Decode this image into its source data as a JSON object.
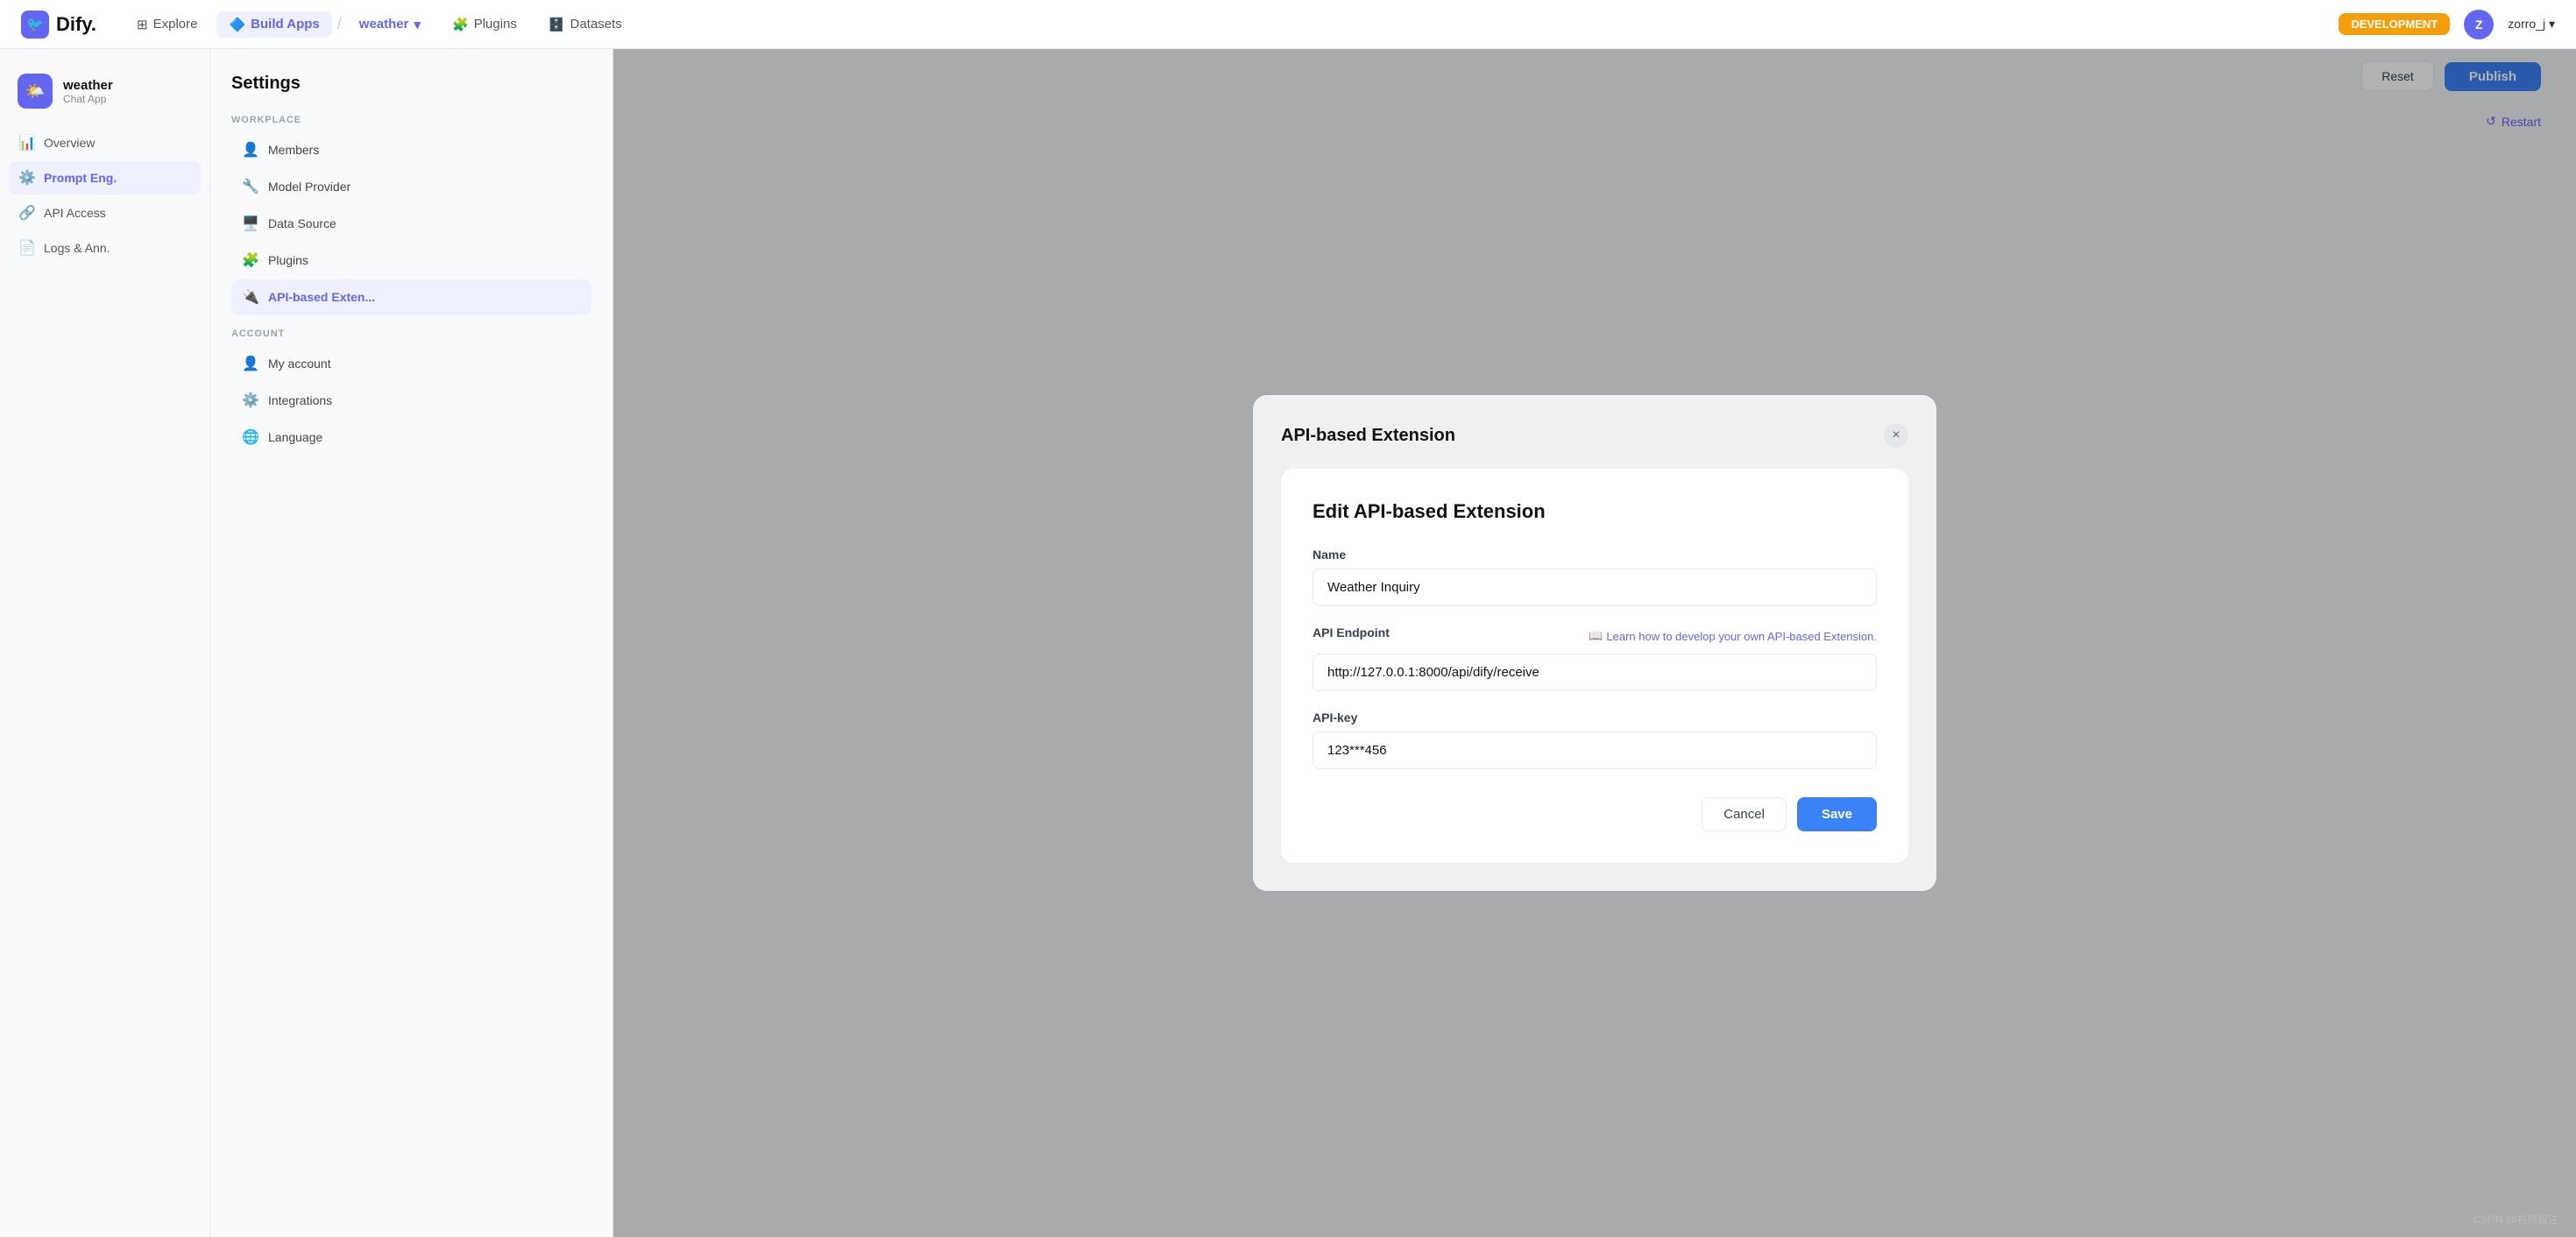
{
  "navbar": {
    "logo_text": "Dify.",
    "explore_label": "Explore",
    "build_apps_label": "Build Apps",
    "app_name": "weather",
    "plugins_label": "Plugins",
    "datasets_label": "Datasets",
    "dev_badge": "DEVELOPMENT",
    "user_avatar": "Z",
    "user_name": "zorro_j"
  },
  "sidebar": {
    "app_name": "weather",
    "app_type": "Chat App",
    "items": [
      {
        "id": "overview",
        "label": "Overview",
        "icon": "📊"
      },
      {
        "id": "prompt-eng",
        "label": "Prompt Eng.",
        "icon": "⚙️",
        "active": true
      },
      {
        "id": "api-access",
        "label": "API Access",
        "icon": "🔗"
      },
      {
        "id": "logs-ann",
        "label": "Logs & Ann.",
        "icon": "📄"
      }
    ]
  },
  "top_right": {
    "reset_label": "Reset",
    "publish_label": "Publish",
    "restart_label": "Restart"
  },
  "settings": {
    "title": "Settings",
    "workplace_section": "WORKPLACE",
    "account_section": "ACCOUNT",
    "items": [
      {
        "id": "members",
        "label": "Members",
        "icon": "👤"
      },
      {
        "id": "model-provider",
        "label": "Model Provider",
        "icon": "🔧"
      },
      {
        "id": "data-source",
        "label": "Data Source",
        "icon": "🖥️"
      },
      {
        "id": "plugins",
        "label": "Plugins",
        "icon": "🧩"
      },
      {
        "id": "api-based-exten",
        "label": "API-based Exten...",
        "icon": "🔌",
        "active": true
      },
      {
        "id": "my-account",
        "label": "My account",
        "icon": "👤"
      },
      {
        "id": "integrations",
        "label": "Integrations",
        "icon": "⚙️"
      },
      {
        "id": "language",
        "label": "Language",
        "icon": "🌐"
      }
    ]
  },
  "outer_modal": {
    "title": "API-based Extension",
    "close_label": "×"
  },
  "inner_modal": {
    "title": "Edit API-based Extension",
    "name_label": "Name",
    "name_value": "Weather Inquiry",
    "name_cursor": true,
    "api_endpoint_label": "API Endpoint",
    "api_endpoint_value": "http://127.0.0.1:8000/api/dify/receive",
    "learn_label": "Learn how to develop your own API-based Extension.",
    "api_key_label": "API-key",
    "api_key_value": "123***456",
    "cancel_label": "Cancel",
    "save_label": "Save"
  },
  "watermark": "CSDN @右侧权注"
}
